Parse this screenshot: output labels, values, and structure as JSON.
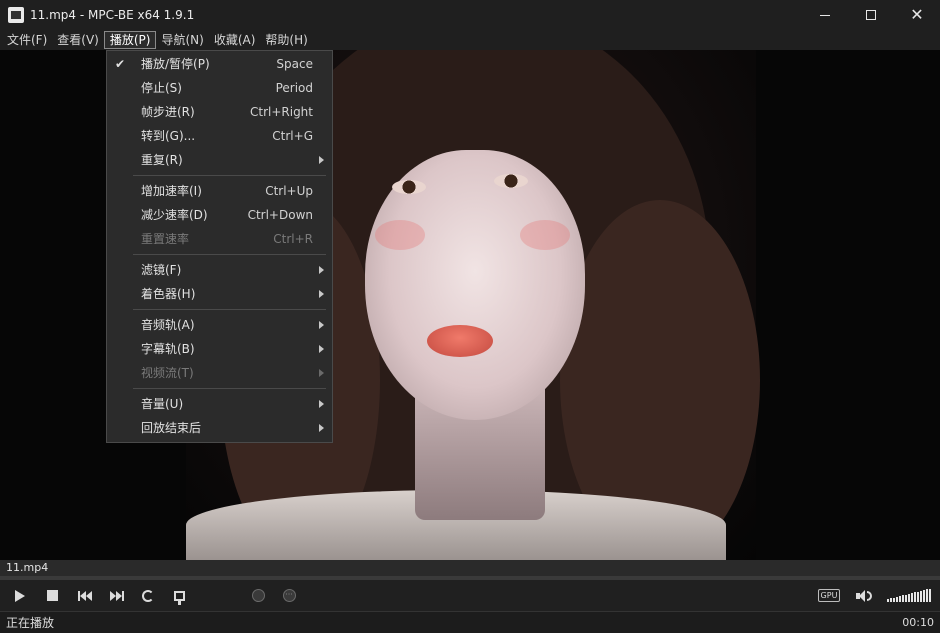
{
  "window": {
    "title": "11.mp4 - MPC-BE x64 1.9.1",
    "icon": "mpc-be-app-icon"
  },
  "menubar": {
    "items": [
      {
        "label": "文件(F)",
        "active": false
      },
      {
        "label": "查看(V)",
        "active": false
      },
      {
        "label": "播放(P)",
        "active": true
      },
      {
        "label": "导航(N)",
        "active": false
      },
      {
        "label": "收藏(A)",
        "active": false
      },
      {
        "label": "帮助(H)",
        "active": false
      }
    ]
  },
  "play_menu": {
    "groups": [
      [
        {
          "label": "播放/暂停(P)",
          "shortcut": "Space",
          "checked": true
        },
        {
          "label": "停止(S)",
          "shortcut": "Period"
        },
        {
          "label": "帧步进(R)",
          "shortcut": "Ctrl+Right"
        },
        {
          "label": "转到(G)...",
          "shortcut": "Ctrl+G"
        },
        {
          "label": "重复(R)",
          "submenu": true
        }
      ],
      [
        {
          "label": "增加速率(I)",
          "shortcut": "Ctrl+Up"
        },
        {
          "label": "减少速率(D)",
          "shortcut": "Ctrl+Down"
        },
        {
          "label": "重置速率",
          "shortcut": "Ctrl+R",
          "disabled": true
        }
      ],
      [
        {
          "label": "滤镜(F)",
          "submenu": true
        },
        {
          "label": "着色器(H)",
          "submenu": true
        }
      ],
      [
        {
          "label": "音频轨(A)",
          "submenu": true
        },
        {
          "label": "字幕轨(B)",
          "submenu": true
        },
        {
          "label": "视频流(T)",
          "submenu": true,
          "disabled": true
        }
      ],
      [
        {
          "label": "音量(U)",
          "submenu": true
        },
        {
          "label": "回放结束后",
          "submenu": true
        }
      ]
    ]
  },
  "seekbar": {
    "filename": "11.mp4"
  },
  "controls": {
    "gpu_label": "GPU",
    "volume_level": 1.0
  },
  "status": {
    "state": "正在播放",
    "time": "00:10"
  }
}
